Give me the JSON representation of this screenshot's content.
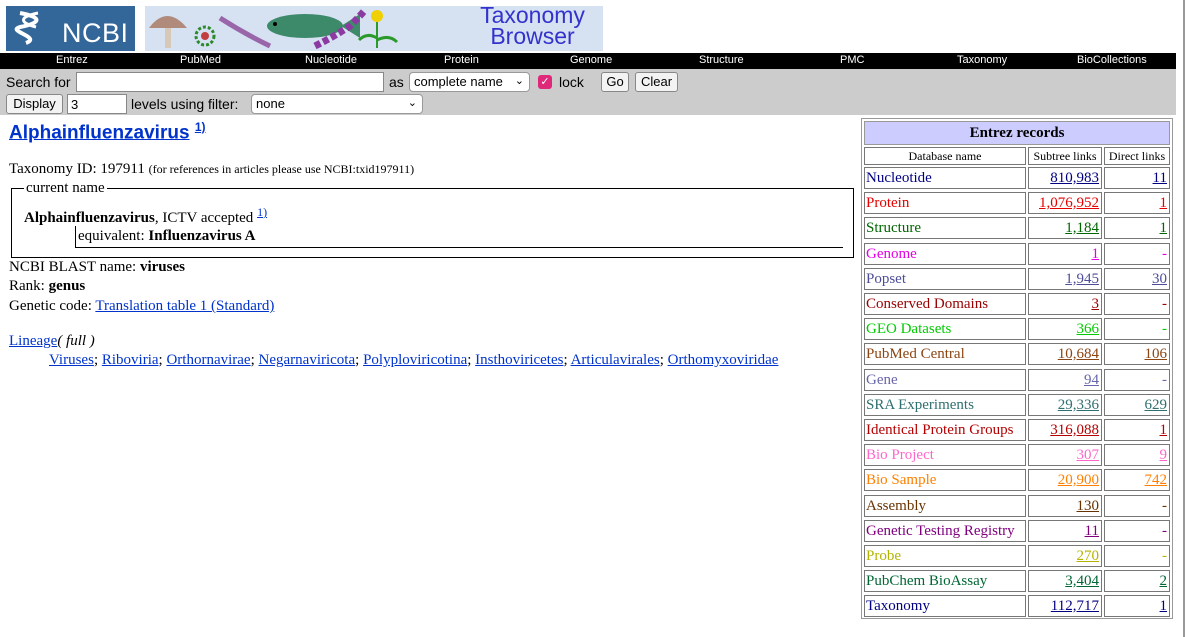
{
  "header": {
    "logo_text": "NCBI",
    "banner_title_line1": "Taxonomy",
    "banner_title_line2": "Browser"
  },
  "nav": [
    "Entrez",
    "PubMed",
    "Nucleotide",
    "Protein",
    "Genome",
    "Structure",
    "PMC",
    "Taxonomy",
    "BioCollections"
  ],
  "search": {
    "search_label": "Search for",
    "search_value": "",
    "as_label": "as",
    "mode_selected": "complete name",
    "lock_label": "lock",
    "go_label": "Go",
    "clear_label": "Clear",
    "display_label": "Display",
    "levels_value": "3",
    "levels_label": "levels using filter:",
    "filter_selected": "none"
  },
  "taxon": {
    "name": "Alphainfluenzavirus",
    "ref_sup": "1)",
    "taxonomy_id_label": "Taxonomy ID: 197911",
    "taxonomy_id_note": "(for references in articles please use NCBI:txid197911)",
    "current_name_legend": "current name",
    "current_name": "Alphainfluenzavirus",
    "current_name_status": ", ICTV accepted ",
    "current_ref_sup": "1)",
    "equivalent_label": "equivalent: ",
    "equivalent_name": "Influenzavirus A",
    "blast_label": "NCBI BLAST name: ",
    "blast_name": "viruses",
    "rank_label": "Rank: ",
    "rank": "genus",
    "genetic_code_label": "Genetic code: ",
    "genetic_code_link": "Translation table 1 (Standard)",
    "lineage_label": "Lineage",
    "lineage_full": "( full )",
    "lineage": [
      "Viruses",
      "Riboviria",
      "Orthornavirae",
      "Negarnaviricota",
      "Polyploviricotina",
      "Insthoviricetes",
      "Articulavirales",
      "Orthomyxoviridae"
    ]
  },
  "entrez": {
    "title": "Entrez records",
    "col_db": "Database name",
    "col_subtree": "Subtree links",
    "col_direct": "Direct links",
    "rows": [
      {
        "name": "Nucleotide",
        "subtree": "810,983",
        "direct": "11",
        "color": "#000080"
      },
      {
        "name": "Protein",
        "subtree": "1,076,952",
        "direct": "1",
        "color": "#e60000"
      },
      {
        "name": "Structure",
        "subtree": "1,184",
        "direct": "1",
        "color": "#006600"
      },
      {
        "name": "Genome",
        "subtree": "1",
        "direct": "-",
        "color": "#e600e6"
      },
      {
        "name": "Popset",
        "subtree": "1,945",
        "direct": "30",
        "color": "#4d4d99"
      },
      {
        "name": "Conserved Domains",
        "subtree": "3",
        "direct": "-",
        "color": "#990000"
      },
      {
        "name": "GEO Datasets",
        "subtree": "366",
        "direct": "-",
        "color": "#00cc00"
      },
      {
        "name": "PubMed Central",
        "subtree": "10,684",
        "direct": "106",
        "color": "#8b4513"
      },
      {
        "name": "Gene",
        "subtree": "94",
        "direct": "-",
        "color": "#6666aa"
      },
      {
        "name": "SRA Experiments",
        "subtree": "29,336",
        "direct": "629",
        "color": "#2f6f6f"
      },
      {
        "name": "Identical Protein Groups",
        "subtree": "316,088",
        "direct": "1",
        "color": "#b30000"
      },
      {
        "name": "Bio Project",
        "subtree": "307",
        "direct": "9",
        "color": "#ff66cc"
      },
      {
        "name": "Bio Sample",
        "subtree": "20,900",
        "direct": "742",
        "color": "#ff8000"
      },
      {
        "name": "Assembly",
        "subtree": "130",
        "direct": "-",
        "color": "#663300"
      },
      {
        "name": "Genetic Testing Registry",
        "subtree": "11",
        "direct": "-",
        "color": "#800080"
      },
      {
        "name": "Probe",
        "subtree": "270",
        "direct": "-",
        "color": "#b3b300"
      },
      {
        "name": "PubChem BioAssay",
        "subtree": "3,404",
        "direct": "2",
        "color": "#006633"
      },
      {
        "name": "Taxonomy",
        "subtree": "112,717",
        "direct": "1",
        "color": "#000080"
      }
    ]
  }
}
